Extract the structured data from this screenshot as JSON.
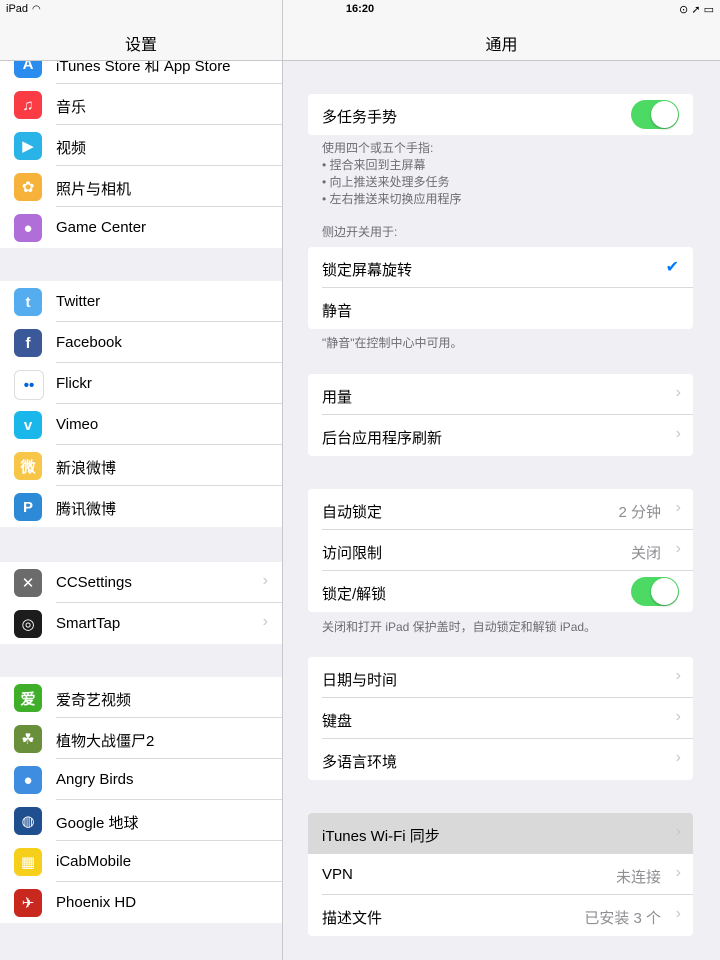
{
  "status_bar": {
    "carrier": "iPad",
    "time": "16:20",
    "right": "⊙ ➚ ▭"
  },
  "master": {
    "title": "设置",
    "groups": [
      {
        "items": [
          {
            "label": "iTunes Store 和 App Store",
            "icon": "app-store-icon",
            "color": "#2b8cf0",
            "glyph": "A"
          },
          {
            "label": "音乐",
            "icon": "music-icon",
            "color": "#fc3c44",
            "glyph": "♫"
          },
          {
            "label": "视频",
            "icon": "videos-icon",
            "color": "#2ab3e6",
            "glyph": "▶"
          },
          {
            "label": "照片与相机",
            "icon": "photos-icon",
            "color": "#f6b23b",
            "glyph": "✿"
          },
          {
            "label": "Game Center",
            "icon": "game-center-icon",
            "color": "#b06fd8",
            "glyph": "●"
          }
        ]
      },
      {
        "items": [
          {
            "label": "Twitter",
            "icon": "twitter-icon",
            "color": "#55acee",
            "glyph": "t"
          },
          {
            "label": "Facebook",
            "icon": "facebook-icon",
            "color": "#3b5998",
            "glyph": "f"
          },
          {
            "label": "Flickr",
            "icon": "flickr-icon",
            "color": "#ffffff",
            "glyph": "••"
          },
          {
            "label": "Vimeo",
            "icon": "vimeo-icon",
            "color": "#1ab7ea",
            "glyph": "v"
          },
          {
            "label": "新浪微博",
            "icon": "weibo-icon",
            "color": "#f7c548",
            "glyph": "微"
          },
          {
            "label": "腾讯微博",
            "icon": "tencent-weibo-icon",
            "color": "#2d8ad6",
            "glyph": "P"
          }
        ]
      },
      {
        "items": [
          {
            "label": "CCSettings",
            "icon": "ccsettings-icon",
            "color": "#6b6b6b",
            "glyph": "✕",
            "chevron": true
          },
          {
            "label": "SmartTap",
            "icon": "smarttap-icon",
            "color": "#1c1c1c",
            "glyph": "◎",
            "chevron": true
          }
        ]
      },
      {
        "items": [
          {
            "label": "爱奇艺视频",
            "icon": "iqiyi-icon",
            "color": "#3fae29",
            "glyph": "爱"
          },
          {
            "label": "植物大战僵尸2",
            "icon": "plants-vs-zombies-icon",
            "color": "#6a8f3a",
            "glyph": "☘"
          },
          {
            "label": "Angry Birds",
            "icon": "angry-birds-icon",
            "color": "#3e8de0",
            "glyph": "●"
          },
          {
            "label": "Google 地球",
            "icon": "google-earth-icon",
            "color": "#1f4f8f",
            "glyph": "◍"
          },
          {
            "label": "iCabMobile",
            "icon": "icabmobile-icon",
            "color": "#f6cf1b",
            "glyph": "▦"
          },
          {
            "label": "Phoenix HD",
            "icon": "phoenix-hd-icon",
            "color": "#c9281f",
            "glyph": "✈"
          }
        ]
      }
    ]
  },
  "detail": {
    "title": "通用",
    "multitask": {
      "label": "多任务手势",
      "on": true
    },
    "multitask_note": [
      "使用四个或五个手指:",
      "• 捏合来回到主屏幕",
      "• 向上推送来处理多任务",
      "• 左右推送来切换应用程序"
    ],
    "side_switch_header": "侧边开关用于:",
    "side_switch": [
      {
        "label": "锁定屏幕旋转",
        "checked": true
      },
      {
        "label": "静音",
        "checked": false
      }
    ],
    "mute_note": "\"静音\"在控制中心中可用。",
    "usage_group": [
      {
        "label": "用量"
      },
      {
        "label": "后台应用程序刷新"
      }
    ],
    "lock_group": [
      {
        "label": "自动锁定",
        "value": "2 分钟",
        "type": "chevron"
      },
      {
        "label": "访问限制",
        "value": "关闭",
        "type": "chevron"
      },
      {
        "label": "锁定/解锁",
        "type": "toggle",
        "on": true
      }
    ],
    "lock_note": "关闭和打开 iPad 保护盖时，自动锁定和解锁 iPad。",
    "date_group": [
      {
        "label": "日期与时间"
      },
      {
        "label": "键盘"
      },
      {
        "label": "多语言环境"
      }
    ],
    "sync_group": [
      {
        "label": "iTunes Wi-Fi 同步",
        "highlighted": true
      },
      {
        "label": "VPN",
        "value": "未连接"
      },
      {
        "label": "描述文件",
        "value": "已安装 3 个"
      }
    ]
  }
}
